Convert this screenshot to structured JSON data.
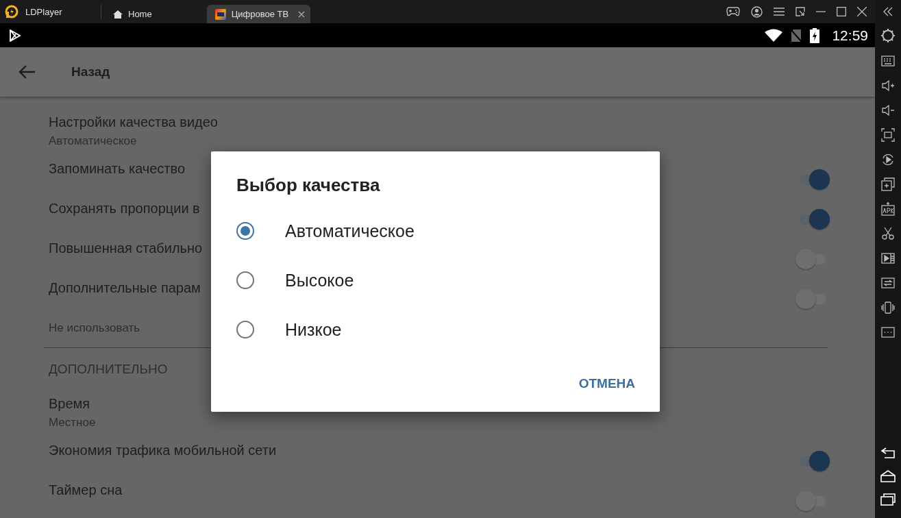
{
  "title_bar": {
    "app_name": "LDPlayer",
    "tabs": [
      {
        "kind": "home",
        "label": "Home",
        "selected": false
      },
      {
        "kind": "app",
        "label": "Цифровое ТВ",
        "selected": true
      }
    ]
  },
  "status_bar": {
    "time": "12:59"
  },
  "app_bar": {
    "title": "Назад"
  },
  "settings": [
    {
      "kind": "item",
      "title": "Настройки качества видео",
      "subtitle": "Автоматическое"
    },
    {
      "kind": "switch",
      "title": "Запоминать качество",
      "on": true
    },
    {
      "kind": "switch",
      "title": "Сохранять пропорции в",
      "on": true
    },
    {
      "kind": "switch",
      "title": "Повышенная стабильно",
      "on": false
    },
    {
      "kind": "switch",
      "title": "Дополнительные парам",
      "subtitle": "Не использовать",
      "on": false
    },
    {
      "kind": "header",
      "title": "ДОПОЛНИТЕЛЬНО"
    },
    {
      "kind": "item",
      "title": "Время",
      "subtitle": "Местное"
    },
    {
      "kind": "switch",
      "title": "Экономия трафика мобильной сети",
      "on": true
    },
    {
      "kind": "switch",
      "title": "Таймер сна",
      "on": false
    }
  ],
  "dialog": {
    "title": "Выбор качества",
    "options": [
      {
        "label": "Автоматическое",
        "selected": true
      },
      {
        "label": "Высокое",
        "selected": false
      },
      {
        "label": "Низкое",
        "selected": false
      }
    ],
    "cancel": "ОТМЕНА"
  }
}
